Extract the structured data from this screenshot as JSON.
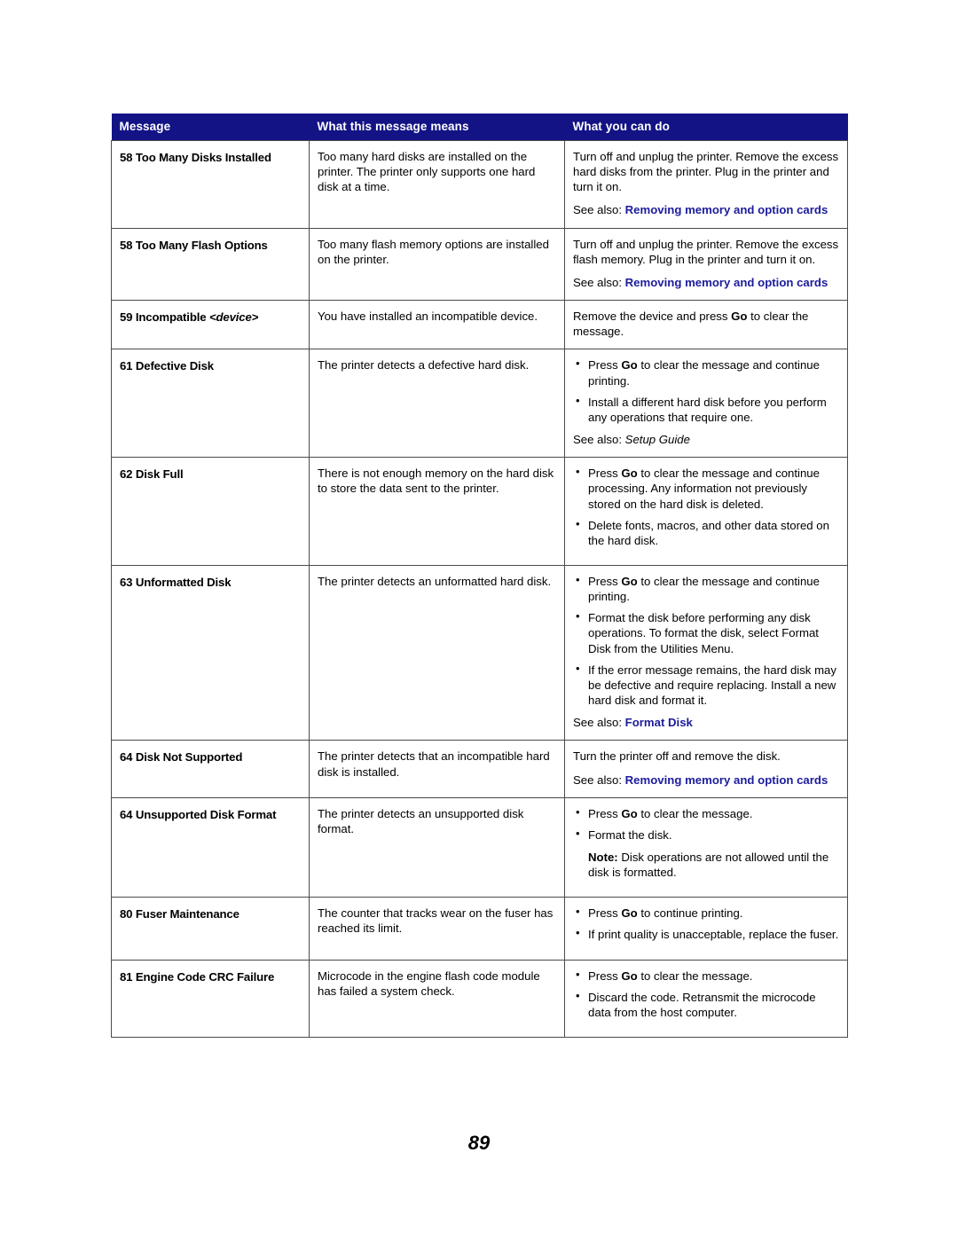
{
  "page": {
    "number": "89"
  },
  "table": {
    "headers": {
      "message": "Message",
      "means": "What this message means",
      "action": "What you can do"
    },
    "colors": {
      "header_bg": "#131386",
      "link_blue": "#1c1c9e",
      "border": "#4a4a4a",
      "body_text": "#000000"
    },
    "rows": [
      {
        "message": "58 Too Many Disks Installed",
        "means": "Too many hard disks are installed on the printer. The printer only supports one hard disk at a time.",
        "action_paragraph": "Turn off and unplug the printer. Remove the excess hard disks from the printer. Plug in the printer and turn it on.",
        "see_also_label": "See also: ",
        "see_also_link": "Removing memory and option cards"
      },
      {
        "message": "58 Too Many Flash Options",
        "means": "Too many flash memory options are installed on the printer.",
        "action_paragraph": "Turn off and unplug the printer. Remove the excess flash memory. Plug in the printer and turn it on.",
        "see_also_label": "See also: ",
        "see_also_link": "Removing memory and option cards"
      },
      {
        "message": "59 Incompatible ",
        "message_device": "<device>",
        "means": "You have installed an incompatible device.",
        "action_pre": "Remove the device and press ",
        "action_bold": "Go",
        "action_post": " to clear the message."
      },
      {
        "message": "61 Defective Disk",
        "means": "The printer detects a defective hard disk.",
        "bullets": [
          {
            "pre": "Press ",
            "bold": "Go",
            "post": " to clear the message and continue printing."
          },
          {
            "pre": "Install a different hard disk before you perform any operations that require one.",
            "bold": "",
            "post": ""
          }
        ],
        "see_also_label": "See also: ",
        "see_also_italic": "Setup Guide"
      },
      {
        "message": "62 Disk Full",
        "means": "There is not enough memory on the hard disk to store the data sent to the printer.",
        "bullets": [
          {
            "pre": "Press ",
            "bold": "Go",
            "post": " to clear the message and continue processing. Any information not previously stored on the hard disk is deleted."
          },
          {
            "pre": "Delete fonts, macros, and other data stored on the hard disk.",
            "bold": "",
            "post": ""
          }
        ]
      },
      {
        "message": "63 Unformatted Disk",
        "means": "The printer detects an unformatted hard disk.",
        "bullets": [
          {
            "pre": "Press ",
            "bold": "Go",
            "post": " to clear the message and continue printing."
          },
          {
            "pre": "Format the disk before performing any disk operations. To format the disk, select Format Disk from the Utilities Menu.",
            "bold": "",
            "post": ""
          },
          {
            "pre": "If the error message remains, the hard disk may be defective and require replacing. Install a new hard disk and format it.",
            "bold": "",
            "post": ""
          }
        ],
        "see_also_label": "See also: ",
        "see_also_link": "Format Disk"
      },
      {
        "message": "64 Disk Not Supported",
        "means": "The printer detects that an incompatible hard disk is installed.",
        "action_paragraph": "Turn the printer off and remove the disk.",
        "see_also_label": "See also: ",
        "see_also_link": "Removing memory and option cards"
      },
      {
        "message": "64 Unsupported Disk Format",
        "means": "The printer detects an unsupported disk format.",
        "bullets": [
          {
            "pre": "Press ",
            "bold": "Go",
            "post": " to clear the message."
          },
          {
            "pre": "Format the disk.",
            "bold": "",
            "post": ""
          }
        ],
        "note_bold": "Note:",
        "note_text": " Disk operations are not allowed until the disk is formatted."
      },
      {
        "message": "80 Fuser Maintenance",
        "means": "The counter that tracks wear on the fuser has reached its limit.",
        "bullets": [
          {
            "pre": "Press ",
            "bold": "Go",
            "post": " to continue printing."
          },
          {
            "pre": "If print quality is unacceptable, replace the fuser.",
            "bold": "",
            "post": ""
          }
        ]
      },
      {
        "message": "81 Engine Code CRC Failure",
        "means": "Microcode in the engine flash code module has failed a system check.",
        "bullets": [
          {
            "pre": "Press ",
            "bold": "Go",
            "post": " to clear the message."
          },
          {
            "pre": "Discard the code. Retransmit the microcode data from the host computer.",
            "bold": "",
            "post": ""
          }
        ]
      }
    ]
  }
}
